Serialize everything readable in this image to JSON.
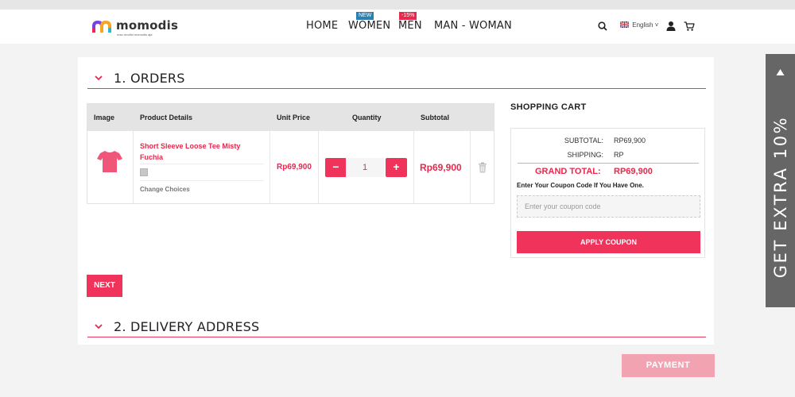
{
  "header": {
    "logo": {
      "name": "momodis",
      "tagline": "mau modist momodis aja"
    },
    "nav": [
      {
        "label": "HOME",
        "badge": ""
      },
      {
        "label": "WOMEN",
        "badge": "NEW"
      },
      {
        "label": "MEN",
        "badge": "-15%"
      },
      {
        "label": "MAN - WOMAN",
        "badge": ""
      }
    ],
    "language": "English",
    "icons": [
      "search-icon",
      "flag-uk-icon",
      "user-icon",
      "cart-icon"
    ]
  },
  "sections": {
    "orders_title": "1. ORDERS",
    "delivery_title": "2. DELIVERY ADDRESS"
  },
  "cart_table": {
    "headers": [
      "Image",
      "Product Details",
      "Unit Price",
      "Quantity",
      "Subtotal"
    ],
    "item": {
      "name": "Short Sleeve Loose Tee Misty Fuchia",
      "change_label": "Change Choices",
      "unit_price": "Rp69,900",
      "quantity": "1",
      "subtotal": "Rp69,900",
      "minus": "−",
      "plus": "+"
    }
  },
  "next_label": "NEXT",
  "shopping_cart": {
    "title": "SHOPPING CART",
    "subtotal_label": "SUBTOTAL:",
    "subtotal_value": "RP69,900",
    "shipping_label": "SHIPPING:",
    "shipping_value": "RP",
    "grand_label": "GRAND TOTAL:",
    "grand_value": "RP69,900",
    "coupon_hint": "Enter Your Coupon Code If You Have One.",
    "coupon_placeholder": "Enter your coupon code",
    "apply_label": "APPLY COUPON"
  },
  "payment_label": "PAYMENT",
  "side_tab": {
    "text": "GET EXTRA 10%"
  },
  "colors": {
    "accent": "#f0335a",
    "accent_text": "#e8284c",
    "payment_disabled": "#f2a3b2",
    "side_tab": "#666666"
  }
}
